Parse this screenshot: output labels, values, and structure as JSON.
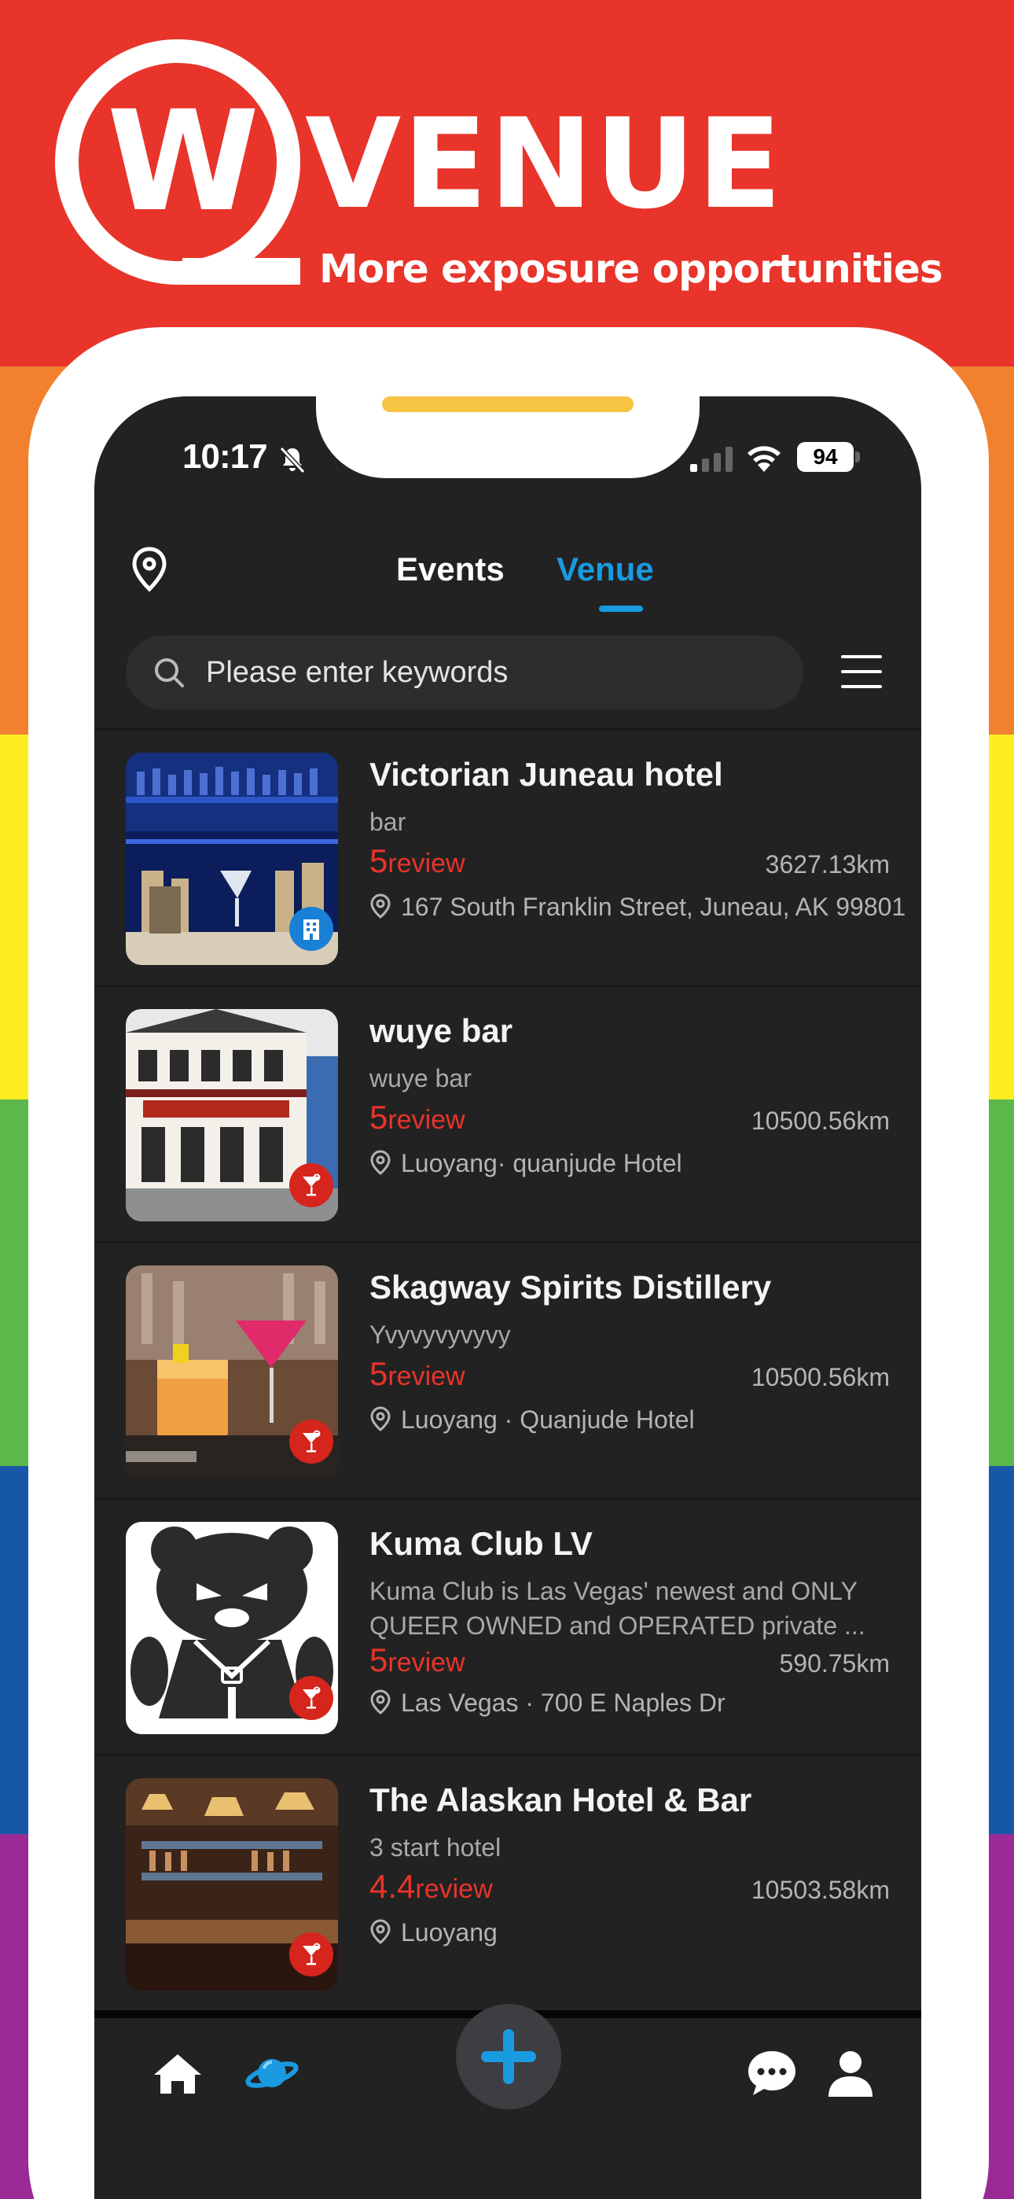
{
  "colors": {
    "red": "#e8342a",
    "orange": "#f1812e",
    "yellow": "#fcee21",
    "green": "#5cb84b",
    "blue": "#1757a8",
    "purple": "#9b2a96",
    "accent": "#1a9ae0",
    "rating": "#e8342a"
  },
  "banner": {
    "logo_letter": "W",
    "title": "VENUE",
    "subtitle": "More exposure opportunities"
  },
  "status_bar": {
    "time": "10:17",
    "battery": "94"
  },
  "nav": {
    "tabs": [
      {
        "label": "Events",
        "active": false
      },
      {
        "label": "Venue",
        "active": true
      }
    ]
  },
  "search": {
    "placeholder": "Please enter keywords"
  },
  "venues": [
    {
      "name": "Victorian Juneau hotel",
      "type": "bar",
      "rating": "5",
      "rating_label": "review",
      "distance": "3627.13km",
      "address": "167 South Franklin Street, Juneau, AK 99801",
      "image": "bar-shelves-photo",
      "badge": "hotel-icon"
    },
    {
      "name": "wuye bar",
      "type": "wuye bar",
      "rating": "5",
      "rating_label": "review",
      "distance": "10500.56km",
      "address": "Luoyang· quanjude Hotel",
      "image": "red-onion-saloon-photo",
      "badge": "cocktail-icon"
    },
    {
      "name": "Skagway Spirits Distillery",
      "type": "Yvyvyvyvyvy",
      "rating": "5",
      "rating_label": "review",
      "distance": "10500.56km",
      "address": "Luoyang · Quanjude Hotel",
      "image": "cocktails-photo",
      "badge": "cocktail-icon"
    },
    {
      "name": "Kuma Club LV",
      "type": "Kuma Club is Las Vegas' newest and ONLY QUEER OWNED and OPERATED private ...",
      "rating": "5",
      "rating_label": "review",
      "distance": "590.75km",
      "address": "Las Vegas · 700 E Naples Dr",
      "image": "bear-logo",
      "badge": "cocktail-icon"
    },
    {
      "name": "The Alaskan Hotel & Bar",
      "type": "3 start hotel",
      "rating": "4.4",
      "rating_label": "review",
      "distance": "10503.58km",
      "address": "Luoyang",
      "image": "saloon-interior-photo",
      "badge": "cocktail-icon"
    }
  ],
  "tabbar": {
    "items": [
      "home-icon",
      "explore-planet-icon",
      "add-icon",
      "chat-icon",
      "profile-icon"
    ],
    "active": "explore-planet-icon"
  }
}
